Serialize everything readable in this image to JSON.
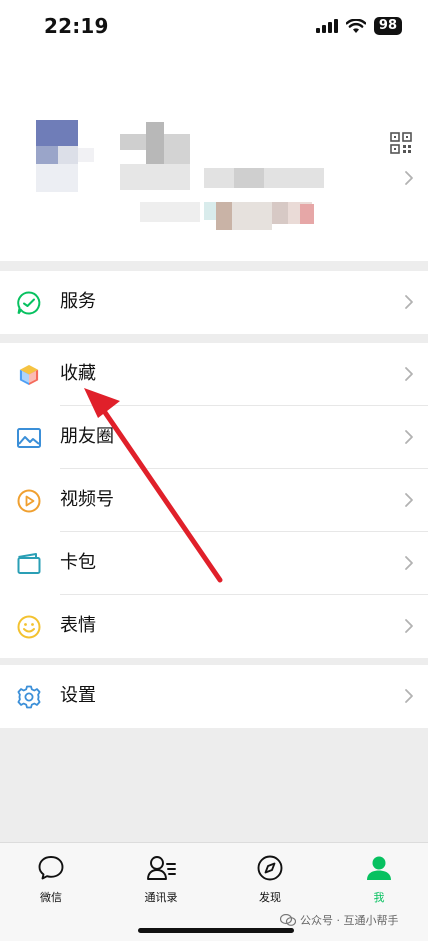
{
  "status_bar": {
    "time": "22:19",
    "battery": "98"
  },
  "menu": {
    "services": "服务",
    "favorites": "收藏",
    "moments": "朋友圈",
    "channels": "视频号",
    "cards": "卡包",
    "stickers": "表情",
    "settings": "设置"
  },
  "tabs": [
    {
      "label": "微信"
    },
    {
      "label": "通讯录"
    },
    {
      "label": "发现"
    },
    {
      "label": "我"
    }
  ],
  "watermark": "公众号 · 互通小帮手",
  "colors": {
    "accent": "#07c160",
    "arrow": "#e0202a"
  }
}
